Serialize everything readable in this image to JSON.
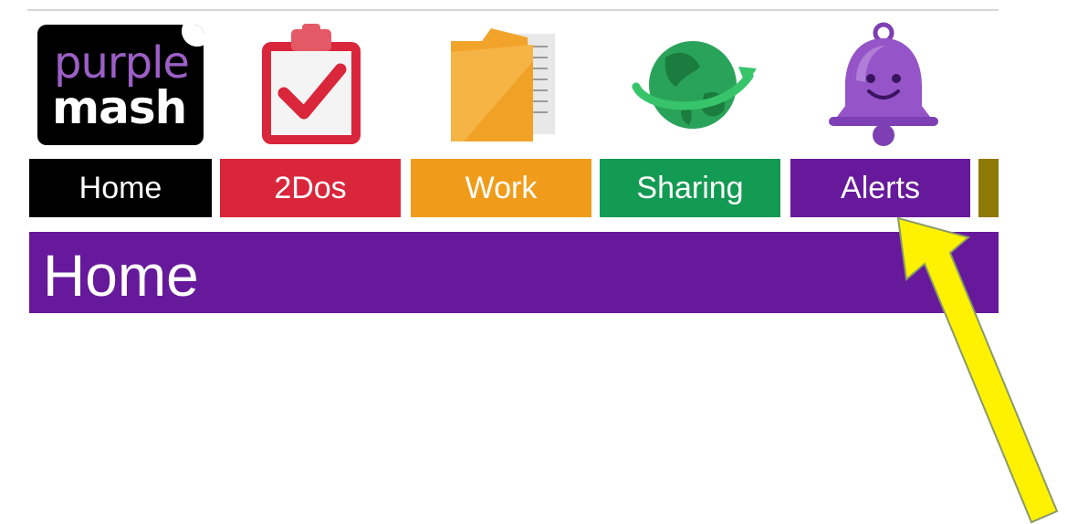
{
  "logo": {
    "line1": "purple",
    "line2": "mash"
  },
  "nav": {
    "items": [
      {
        "label": "Home",
        "icon": "logo-icon",
        "color": "#000000"
      },
      {
        "label": "2Dos",
        "icon": "clipboard-check-icon",
        "color": "#d9263b"
      },
      {
        "label": "Work",
        "icon": "folder-icon",
        "color": "#f09c1a"
      },
      {
        "label": "Sharing",
        "icon": "globe-icon",
        "color": "#139a53"
      },
      {
        "label": "Alerts",
        "icon": "bell-icon",
        "color": "#66199a"
      }
    ],
    "overflow_color": "#8f7a08"
  },
  "page": {
    "title": "Home",
    "title_bar_color": "#66199a"
  },
  "annotation": {
    "arrow_color": "#fff200",
    "points_to": "Alerts"
  }
}
